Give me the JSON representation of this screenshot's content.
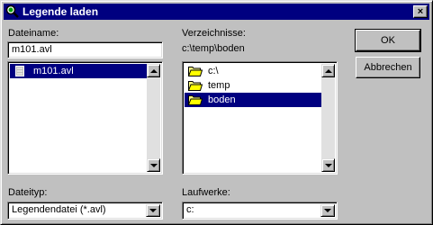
{
  "window": {
    "title": "Legende laden",
    "close_glyph": "×"
  },
  "file": {
    "label": "Dateiname:",
    "value": "m101.avl",
    "items": [
      {
        "label": "m101.avl",
        "selected": true
      }
    ]
  },
  "dirs": {
    "label": "Verzeichnisse:",
    "path": "c:\\temp\\boden",
    "items": [
      {
        "label": "c:\\",
        "selected": false
      },
      {
        "label": "temp",
        "selected": false
      },
      {
        "label": "boden",
        "selected": true
      }
    ]
  },
  "buttons": {
    "ok": "OK",
    "cancel": "Abbrechen"
  },
  "filetype": {
    "label": "Dateityp:",
    "value": "Legendendatei (*.avl)"
  },
  "drives": {
    "label": "Laufwerke:",
    "value": "c:"
  },
  "icons": {
    "title": "magnifier-icon",
    "folder": "folder-icon",
    "file": "file-icon"
  },
  "colors": {
    "title_bar": "#000080",
    "selection": "#000080",
    "face": "#c0c0c0"
  }
}
